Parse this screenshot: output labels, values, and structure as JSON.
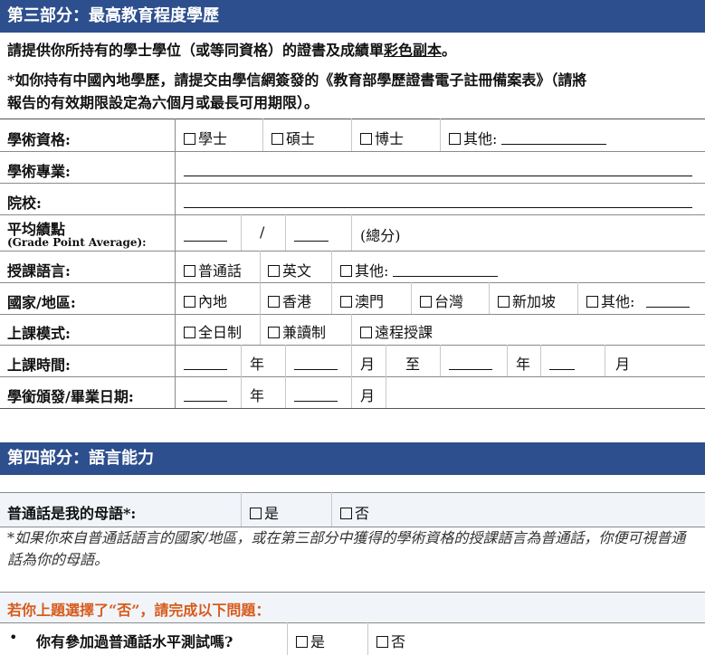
{
  "section3": {
    "title": "第三部分：最高教育程度學歷",
    "intro_main": "請提供你所持有的學士學位（或等同資格）的證書及成績單",
    "intro_underlined": "彩色副本",
    "intro_end": "。",
    "note_line1": "*如你持有中國內地學歷，請提交由學信網簽發的《教育部學歷證書電子註冊備案表》（請將",
    "note_line2": "報告的有效期限設定為六個月或最長可用期限）。",
    "rows": {
      "qualification": {
        "label": "學術資格:",
        "opt1": "學士",
        "opt2": "碩士",
        "opt3": "博士",
        "opt4": "其他:"
      },
      "major": {
        "label": "學術專業:"
      },
      "institution": {
        "label": "院校:"
      },
      "gpa": {
        "label": "平均績點",
        "label_sub": "(Grade Point Average):",
        "separator": "/",
        "total": "(總分)"
      },
      "teaching_language": {
        "label": "授課語言:",
        "opt1": "普通話",
        "opt2": "英文",
        "opt3": "其他:"
      },
      "country": {
        "label": "國家/地區:",
        "opt1": "內地",
        "opt2": "香港",
        "opt3": "澳門",
        "opt4": "台灣",
        "opt5": "新加坡",
        "opt6": "其他:"
      },
      "mode": {
        "label": "上課模式:",
        "opt1": "全日制",
        "opt2": "兼讀制",
        "opt3": "遠程授課"
      },
      "period": {
        "label": "上課時間:",
        "year": "年",
        "month": "月",
        "to": "至",
        "year2": "年",
        "month2": "月"
      },
      "award_date": {
        "label": "學銜頒發/畢業日期:",
        "year": "年",
        "month": "月"
      }
    }
  },
  "section4": {
    "title": "第四部分：語言能力",
    "native_label": "普通話是我的母語*:",
    "yes": "是",
    "no": "否",
    "note": "*如果你來自普通話語言的國家/地區，或在第三部分中獲得的學術資格的授課語言為普通話，你便可視普通話為你的母語。",
    "followup": "若你上題選擇了“否”，請完成以下問題：",
    "bullet": "•",
    "test_question": "你有參加過普通話水平測試嗎?",
    "test_yes": "是",
    "test_no": "否"
  }
}
